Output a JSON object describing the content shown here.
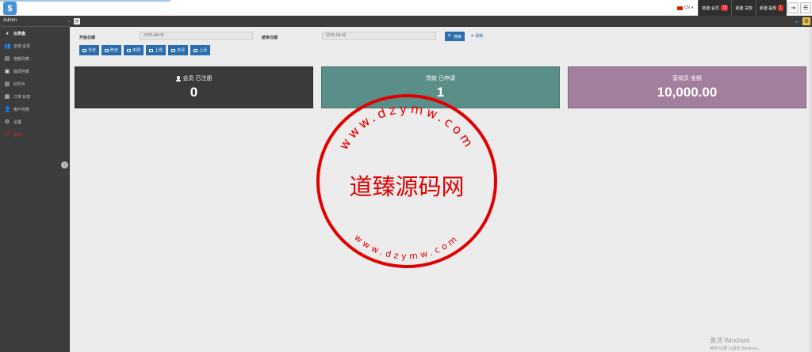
{
  "header": {
    "logo_glyph": "$",
    "lang": "CN",
    "notifications": [
      {
        "label": "新建 会员",
        "count": "15"
      },
      {
        "label": "新建 贷款",
        "count": ""
      },
      {
        "label": "新建 提现",
        "count": "1"
      }
    ],
    "logout_glyph": "⇥",
    "menu_glyph": "☰"
  },
  "sidebar": {
    "title": "Admin",
    "items": [
      {
        "label": "仪表盘",
        "icon": "dashboard-icon",
        "glyph": "◕"
      },
      {
        "label": "全部 会员",
        "icon": "users-icon",
        "glyph": "👥"
      },
      {
        "label": "借款列表",
        "icon": "list-icon",
        "glyph": "▤"
      },
      {
        "label": "提现列表",
        "icon": "money-icon",
        "glyph": "▣"
      },
      {
        "label": "幻灯片",
        "icon": "slides-icon",
        "glyph": "▥"
      },
      {
        "label": "订单 状态",
        "icon": "calendar-icon",
        "glyph": "▦"
      },
      {
        "label": "用户列表",
        "icon": "user-icon",
        "glyph": "👤"
      },
      {
        "label": "设置",
        "icon": "gear-icon",
        "glyph": "⚙"
      },
      {
        "label": "退出",
        "icon": "power-icon",
        "glyph": "⏻"
      }
    ],
    "collapse_glyph": "‹"
  },
  "breadcrumb": {
    "refresh_glyph": "⟳",
    "right1_glyph": "↩",
    "right2_glyph": "⚙"
  },
  "filter": {
    "start_label": "开始日期",
    "start_value": "2025-08-02",
    "end_label": "结束日期",
    "end_value": "2025-08-02",
    "search_label": "搜索",
    "reset_label": "刷新",
    "quick": [
      "今天",
      "昨天",
      "本周",
      "上周",
      "本月",
      "上月"
    ]
  },
  "stats": [
    {
      "caption": "会员 已注册",
      "value": "0",
      "color": "#3a3a3a"
    },
    {
      "caption": "贷款 已申请",
      "value": "1",
      "color": "#5a8e88"
    },
    {
      "caption": "营销员 金额",
      "value": "10,000.00",
      "color": "#a27f9c"
    }
  ],
  "watermark": {
    "top_arc": "www.dzymw.com",
    "center": "道臻源码网",
    "bottom_arc": "www.dzymw.com",
    "color": "#e00000"
  },
  "windows": {
    "line1": "激活 Windows",
    "line2": "转到\"设置\"以激活 Windows。"
  }
}
